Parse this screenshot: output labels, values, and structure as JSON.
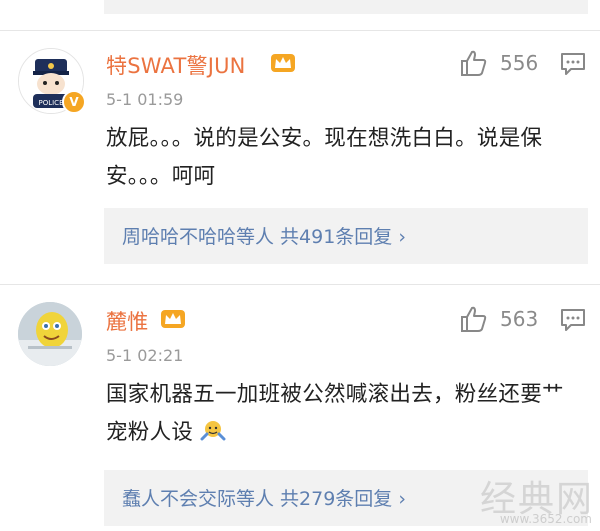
{
  "comments": [
    {
      "username": "特SWAT警JUN",
      "time": "5-1 01:59",
      "likes": "556",
      "text": "放屁。。。说的是公安。现在想洗白白。说是保安。。。呵呵",
      "reply_summary": "周哈哈不哈哈等人 共491条回复 ›"
    },
    {
      "username": "麓惟",
      "time": "5-1 02:21",
      "likes": "563",
      "text": "国家机器五一加班被公然喊滚出去，粉丝还要艹宠粉人设",
      "reply_summary": "蠢人不会交际等人 共279条回复 ›"
    }
  ],
  "watermark": {
    "text": "经典网",
    "url": "www.3652.com"
  },
  "colors": {
    "username": "#eb7340",
    "link": "#5e7fb0",
    "reply_bg": "#f2f2f2",
    "badge": "#f5a623"
  }
}
